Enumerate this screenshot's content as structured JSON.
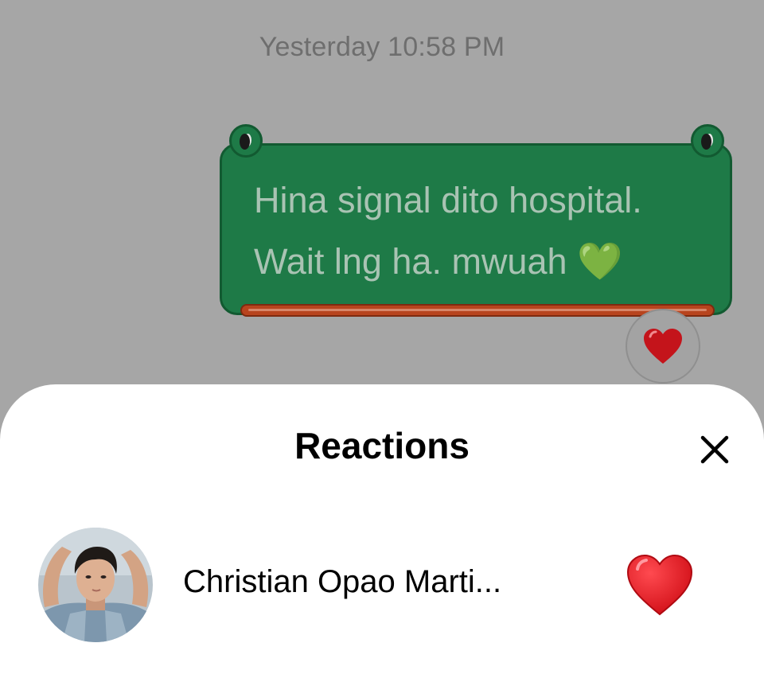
{
  "chat": {
    "timestamp": "Yesterday 10:58 PM",
    "message": {
      "line1": "Hina signal dito hospital.",
      "line2": "Wait lng ha. mwuah",
      "emoji": "💚",
      "reaction_icon": "heart-icon"
    }
  },
  "reactions_sheet": {
    "title": "Reactions",
    "close_icon": "close-icon",
    "entries": [
      {
        "name": "Christian Opao Marti...",
        "reaction_icon": "heart-icon"
      }
    ]
  },
  "colors": {
    "bubble": "#1e7a47",
    "heart": "#e0151d",
    "overlay": "#a6a6a6"
  }
}
